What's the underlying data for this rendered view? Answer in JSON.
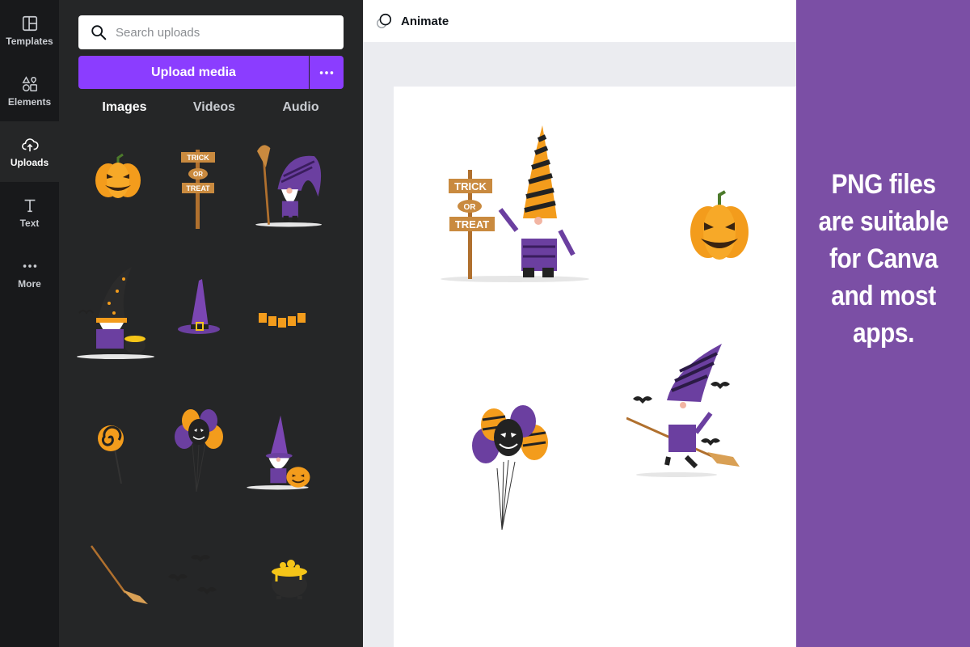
{
  "rail": {
    "items": [
      {
        "label": "Templates",
        "icon": "templates-icon"
      },
      {
        "label": "Elements",
        "icon": "elements-icon"
      },
      {
        "label": "Uploads",
        "icon": "upload-cloud-icon",
        "active": true
      },
      {
        "label": "Text",
        "icon": "text-icon"
      },
      {
        "label": "More",
        "icon": "more-dots-icon"
      }
    ]
  },
  "panel": {
    "search_placeholder": "Search uploads",
    "upload_label": "Upload media",
    "tabs": [
      {
        "label": "Images",
        "active": true
      },
      {
        "label": "Videos"
      },
      {
        "label": "Audio"
      }
    ],
    "thumbnails": [
      "pumpkin",
      "trick-or-treat-sign",
      "gnome-with-broom",
      "gnome-with-cauldron",
      "witch-hat",
      "boo-banner",
      "lollipop",
      "balloons",
      "gnome-with-pumpkin",
      "broom",
      "bats",
      "cauldron"
    ]
  },
  "editor": {
    "animate_label": "Animate",
    "canvas_items": [
      "gnome-with-sign",
      "pumpkin",
      "balloons",
      "gnome-on-broom"
    ]
  },
  "promo": {
    "text": "PNG files are suitable for Canva and most apps."
  },
  "colors": {
    "accent": "#8b3dff",
    "rail_bg": "#18191b",
    "panel_bg": "#252627",
    "promo_bg": "#7b4fa5",
    "pumpkin": "#f39c1c",
    "purple": "#6b3fa0"
  }
}
